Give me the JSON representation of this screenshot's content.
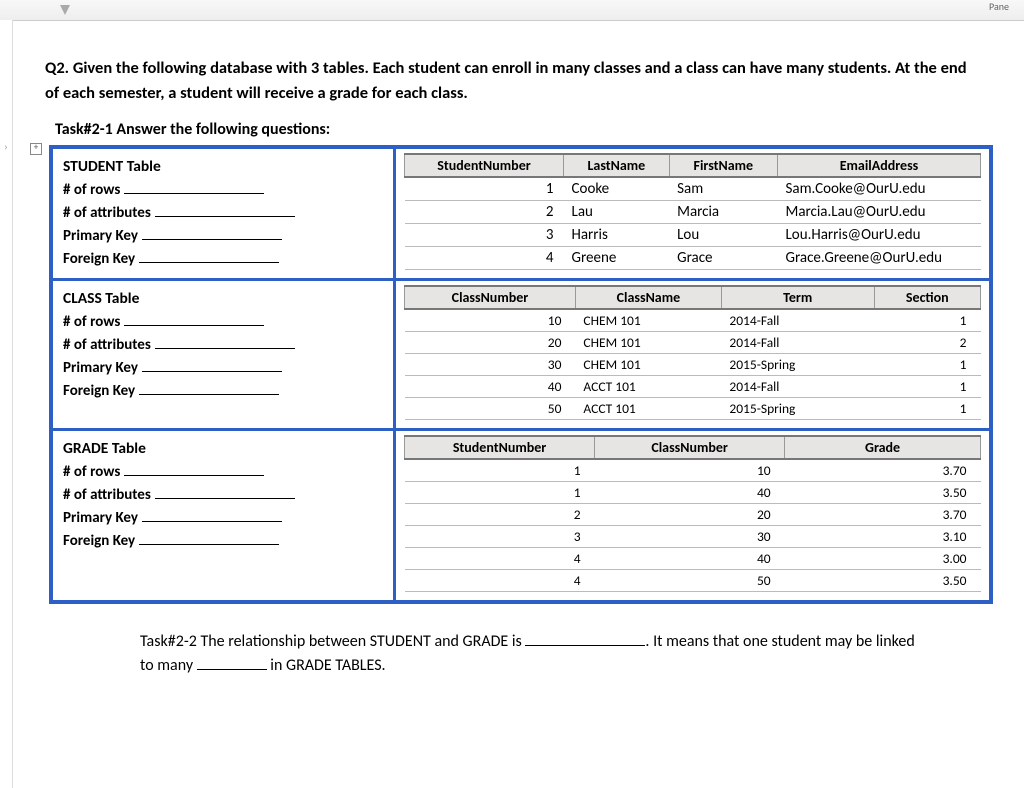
{
  "pane_label": "Pane",
  "question": "Q2.  Given the following database with 3 tables. Each student can enroll in many classes and a class can have many students. At the end of each semester, a student will receive a grade for each class.",
  "task21_heading": "Task#2-1 Answer the following questions:",
  "meta_labels": {
    "rows": "# of rows",
    "attrs": "# of attributes",
    "pk": "Primary Key",
    "fk": "Foreign Key"
  },
  "student": {
    "title": "STUDENT Table",
    "headers": [
      "StudentNumber",
      "LastName",
      "FirstName",
      "EmailAddress"
    ],
    "rows": [
      {
        "num": "1",
        "last": "Cooke",
        "first": "Sam",
        "email": "Sam.Cooke@OurU.edu"
      },
      {
        "num": "2",
        "last": "Lau",
        "first": "Marcia",
        "email": "Marcia.Lau@OurU.edu"
      },
      {
        "num": "3",
        "last": "Harris",
        "first": "Lou",
        "email": "Lou.Harris@OurU.edu"
      },
      {
        "num": "4",
        "last": "Greene",
        "first": "Grace",
        "email": "Grace.Greene@OurU.edu"
      }
    ]
  },
  "classt": {
    "title": "CLASS Table",
    "headers": [
      "ClassNumber",
      "ClassName",
      "Term",
      "Section"
    ],
    "rows": [
      {
        "num": "10",
        "name": "CHEM 101",
        "term": "2014-Fall",
        "sec": "1"
      },
      {
        "num": "20",
        "name": "CHEM 101",
        "term": "2014-Fall",
        "sec": "2"
      },
      {
        "num": "30",
        "name": "CHEM 101",
        "term": "2015-Spring",
        "sec": "1"
      },
      {
        "num": "40",
        "name": "ACCT 101",
        "term": "2014-Fall",
        "sec": "1"
      },
      {
        "num": "50",
        "name": "ACCT 101",
        "term": "2015-Spring",
        "sec": "1"
      }
    ]
  },
  "gradet": {
    "title": "GRADE Table",
    "headers": [
      "StudentNumber",
      "ClassNumber",
      "Grade"
    ],
    "rows": [
      {
        "s": "1",
        "c": "10",
        "g": "3.70"
      },
      {
        "s": "1",
        "c": "40",
        "g": "3.50"
      },
      {
        "s": "2",
        "c": "20",
        "g": "3.70"
      },
      {
        "s": "3",
        "c": "30",
        "g": "3.10"
      },
      {
        "s": "4",
        "c": "40",
        "g": "3.00"
      },
      {
        "s": "4",
        "c": "50",
        "g": "3.50"
      }
    ]
  },
  "task22": {
    "prefix": "Task#2-2 The relationship between STUDENT and GRADE is ",
    "mid": ". It means that one student may be linked to many ",
    "suffix": " in GRADE TABLES."
  }
}
